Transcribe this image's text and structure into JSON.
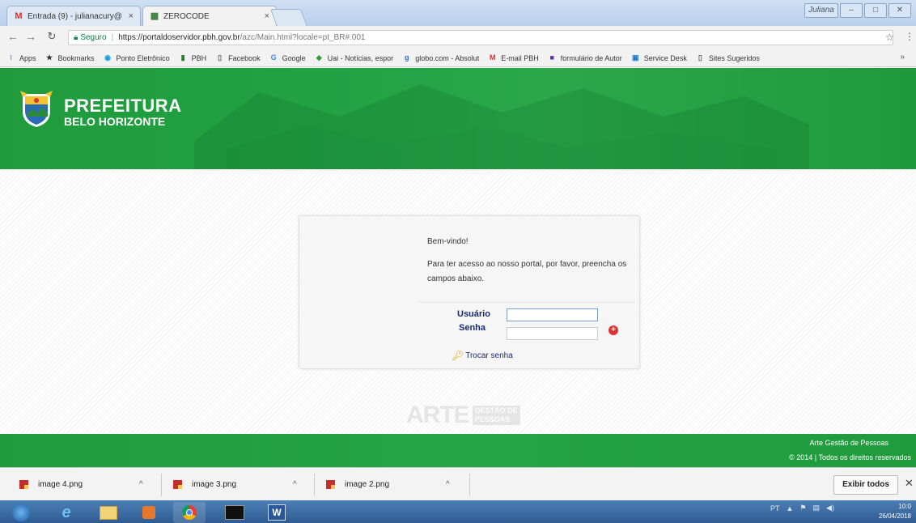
{
  "window": {
    "tabs": [
      {
        "label": "Entrada (9) - julianacury@",
        "icon": "gmail-icon",
        "active": false
      },
      {
        "label": "ZEROCODE",
        "icon": "pbh-favicon-icon",
        "active": true
      }
    ],
    "profile": "Juliana",
    "controls": [
      "minimize",
      "maximize",
      "close"
    ]
  },
  "addressbar": {
    "secure_label": "Seguro",
    "url_host": "https://portaldoservidor.pbh.gov.br",
    "url_path": "/azc/Main.html?locale=pt_BR#.001"
  },
  "bookmarks": [
    {
      "label": "Apps",
      "icon": "apps-grid-icon",
      "color": "#4285f4"
    },
    {
      "label": "Bookmarks",
      "icon": "star-icon",
      "color": "#333333"
    },
    {
      "label": "Ponto Eletrônico",
      "icon": "ponto-icon",
      "color": "#1a9bd7"
    },
    {
      "label": "PBH",
      "icon": "pbh-icon",
      "color": "#2a7a2a"
    },
    {
      "label": "Facebook",
      "icon": "page-icon",
      "color": "#666666"
    },
    {
      "label": "Google",
      "icon": "google-icon",
      "color": "#4285f4"
    },
    {
      "label": "Uai - Notícias, espor",
      "icon": "uai-icon",
      "color": "#3a9a3a"
    },
    {
      "label": "globo.com - Absolut",
      "icon": "globo-icon",
      "color": "#2a6bd1"
    },
    {
      "label": "E-mail PBH",
      "icon": "gmail-icon",
      "color": "#d93025"
    },
    {
      "label": "formulário de Autor",
      "icon": "form-icon",
      "color": "#5a2ca0"
    },
    {
      "label": "Service Desk",
      "icon": "service-desk-icon",
      "color": "#1a7bd1"
    },
    {
      "label": "Sites Sugeridos",
      "icon": "page-icon",
      "color": "#666666"
    }
  ],
  "header": {
    "brand_line1": "PREFEITURA",
    "brand_line2": "BELO HORIZONTE",
    "color": "#22a344"
  },
  "login": {
    "welcome": "Bem-vindo!",
    "instructions": "Para ter acesso ao nosso portal, por favor, preencha os campos abaixo.",
    "user_label": "Usuário",
    "password_label": "Senha",
    "user_value": "",
    "password_value": "",
    "change_password": "Trocar senha"
  },
  "watermark": {
    "arte": "ARTE",
    "line1": "GESTÃO DE",
    "line2": "PESSOAS"
  },
  "footer": {
    "line1": "Arte Gestão de Pessoas",
    "line2": "© 2014 | Todos os direitos reservados"
  },
  "downloads": {
    "items": [
      "image 4.png",
      "image 3.png",
      "image 2.png"
    ],
    "show_all": "Exibir todos"
  },
  "taskbar": {
    "language": "PT",
    "time": "10:0",
    "date": "26/04/2018"
  }
}
